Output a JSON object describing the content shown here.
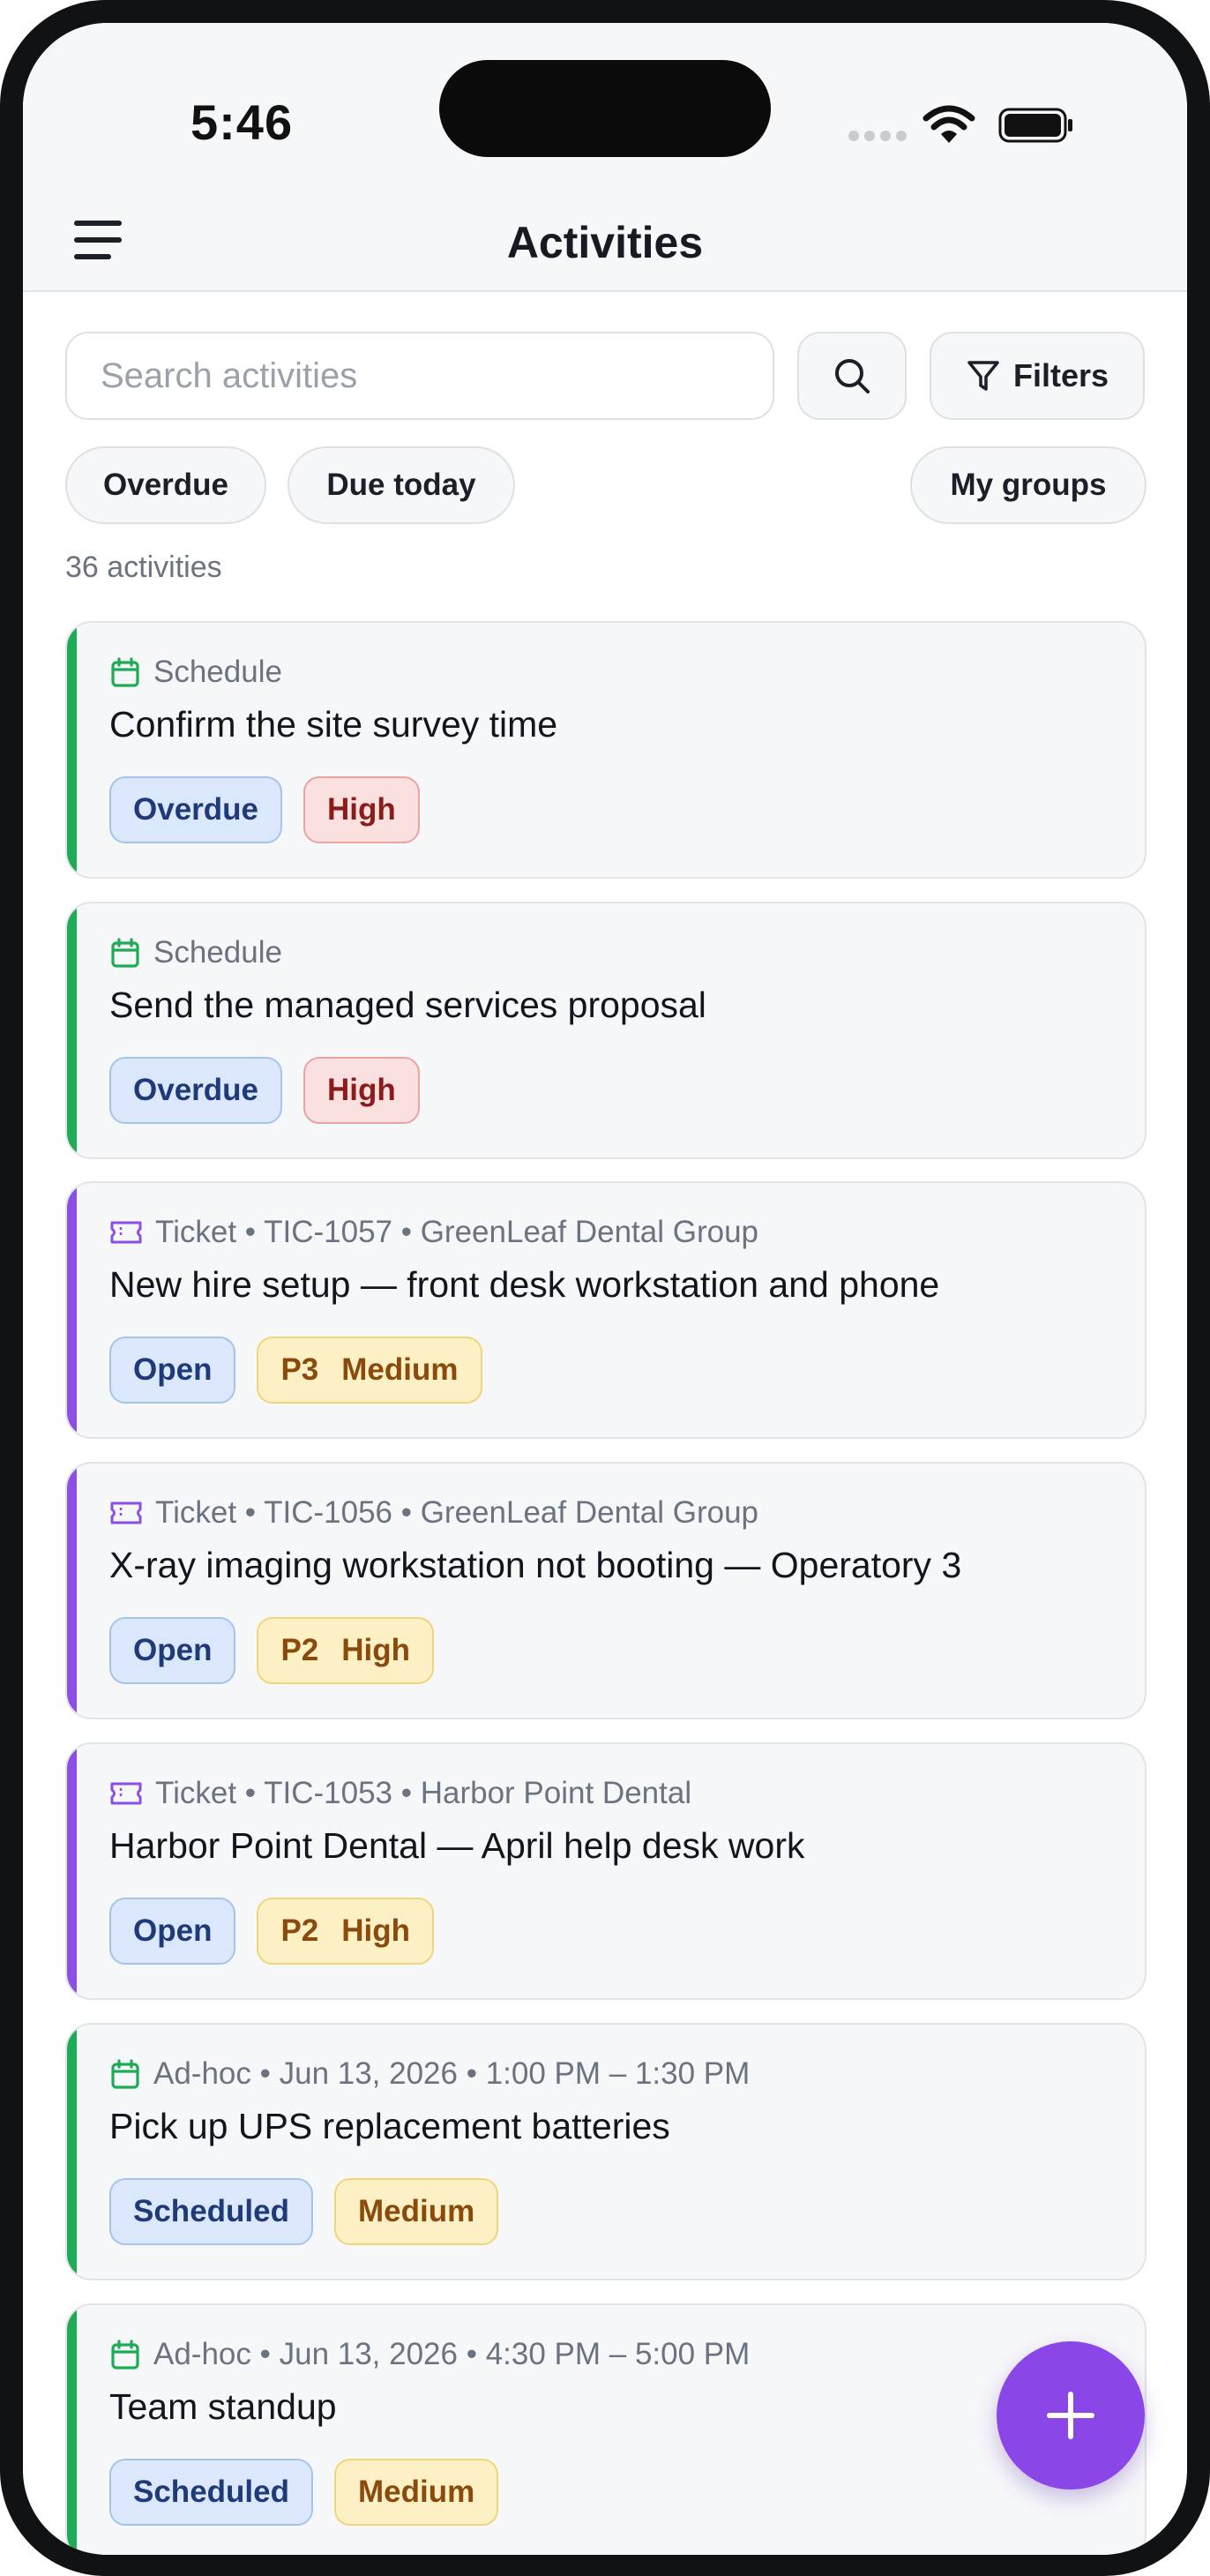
{
  "status_bar": {
    "time": "5:46"
  },
  "app_bar": {
    "title": "Activities"
  },
  "search": {
    "placeholder": "Search activities"
  },
  "toolbar": {
    "filters_label": "Filters"
  },
  "chips": [
    {
      "label": "Overdue"
    },
    {
      "label": "Due today"
    },
    {
      "label": "My groups"
    }
  ],
  "activity_count": "36 activities",
  "colors": {
    "schedule": "#1faa55",
    "ticket": "#8b4fe6",
    "fab": "#8b46e8"
  },
  "activities": [
    {
      "type": "schedule",
      "icon": "calendar-icon",
      "meta": "Schedule",
      "title": "Confirm the site survey time",
      "badges": [
        {
          "text": "Overdue",
          "tone": "blue"
        },
        {
          "text": "High",
          "tone": "red"
        }
      ]
    },
    {
      "type": "schedule",
      "icon": "calendar-icon",
      "meta": "Schedule",
      "title": "Send the managed services proposal",
      "badges": [
        {
          "text": "Overdue",
          "tone": "blue"
        },
        {
          "text": "High",
          "tone": "red"
        }
      ]
    },
    {
      "type": "ticket",
      "icon": "ticket-icon",
      "meta": "Ticket • TIC-1057 • GreenLeaf Dental Group",
      "title": "New hire setup — front desk workstation and phone",
      "badges": [
        {
          "text": "Open",
          "tone": "blue"
        },
        {
          "text": "P3",
          "text2": "Medium",
          "tone": "amber"
        }
      ]
    },
    {
      "type": "ticket",
      "icon": "ticket-icon",
      "meta": "Ticket • TIC-1056 • GreenLeaf Dental Group",
      "title": "X-ray imaging workstation not booting — Operatory 3",
      "badges": [
        {
          "text": "Open",
          "tone": "blue"
        },
        {
          "text": "P2",
          "text2": "High",
          "tone": "amber"
        }
      ]
    },
    {
      "type": "ticket",
      "icon": "ticket-icon",
      "meta": "Ticket • TIC-1053 • Harbor Point Dental",
      "title": "Harbor Point Dental — April help desk work",
      "badges": [
        {
          "text": "Open",
          "tone": "blue"
        },
        {
          "text": "P2",
          "text2": "High",
          "tone": "amber"
        }
      ]
    },
    {
      "type": "schedule",
      "icon": "calendar-icon",
      "meta": "Ad-hoc • Jun 13, 2026 • 1:00 PM – 1:30 PM",
      "title": "Pick up UPS replacement batteries",
      "badges": [
        {
          "text": "Scheduled",
          "tone": "blue"
        },
        {
          "text": "Medium",
          "tone": "amber"
        }
      ]
    },
    {
      "type": "schedule",
      "icon": "calendar-icon",
      "meta": "Ad-hoc • Jun 13, 2026 • 4:30 PM – 5:00 PM",
      "title": "Team standup",
      "badges": [
        {
          "text": "Scheduled",
          "tone": "blue"
        },
        {
          "text": "Medium",
          "tone": "amber"
        }
      ]
    }
  ]
}
